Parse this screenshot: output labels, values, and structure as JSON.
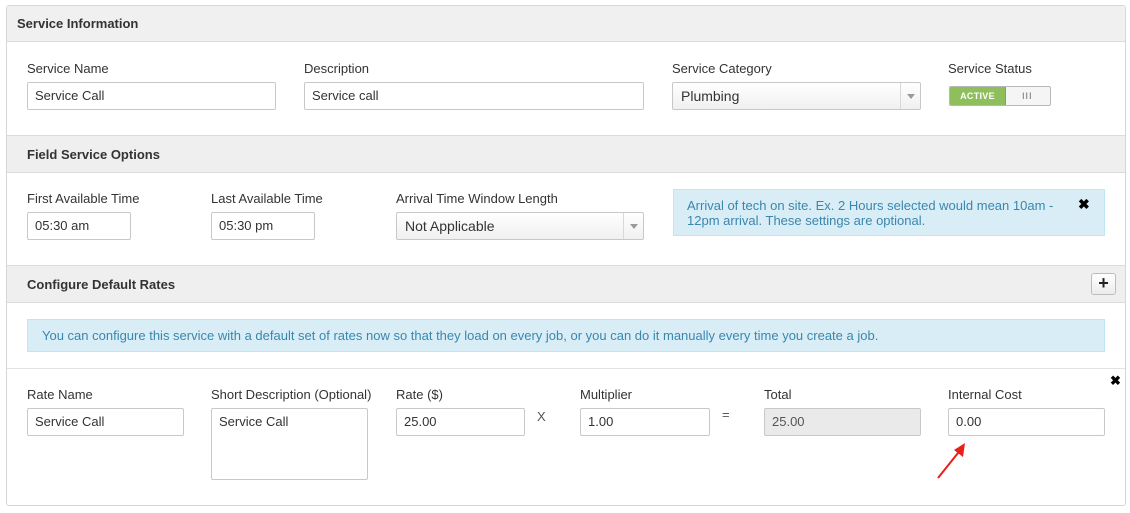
{
  "service_info": {
    "heading": "Service Information",
    "name_label": "Service Name",
    "name_value": "Service Call",
    "description_label": "Description",
    "description_value": "Service call",
    "category_label": "Service Category",
    "category_value": "Plumbing",
    "status_label": "Service Status",
    "status_on_text": "ACTIVE",
    "status_grip": "III"
  },
  "field_options": {
    "heading": "Field Service Options",
    "first_time_label": "First Available Time",
    "first_time_value": "05:30 am",
    "last_time_label": "Last Available Time",
    "last_time_value": "05:30 pm",
    "window_label": "Arrival Time Window Length",
    "window_value": "Not Applicable",
    "info_text": "Arrival of tech on site. Ex. 2 Hours selected would mean 10am - 12pm arrival. These settings are optional.",
    "info_close": "✖"
  },
  "default_rates": {
    "heading": "Configure Default Rates",
    "add_label": "+",
    "info_text": "You can configure this service with a default set of rates now so that they load on every job, or you can do it manually every time you create a job.",
    "row_close": "✖",
    "rate_name_label": "Rate Name",
    "rate_name_value": "Service Call",
    "short_desc_label": "Short Description (Optional)",
    "short_desc_value": "Service Call",
    "rate_label": "Rate ($)",
    "rate_value": "25.00",
    "times_symbol": "X",
    "multiplier_label": "Multiplier",
    "multiplier_value": "1.00",
    "equals_symbol": "=",
    "total_label": "Total",
    "total_value": "25.00",
    "internal_cost_label": "Internal Cost",
    "internal_cost_value": "0.00"
  },
  "annotation": {
    "arrow_color": "#e8201c"
  }
}
